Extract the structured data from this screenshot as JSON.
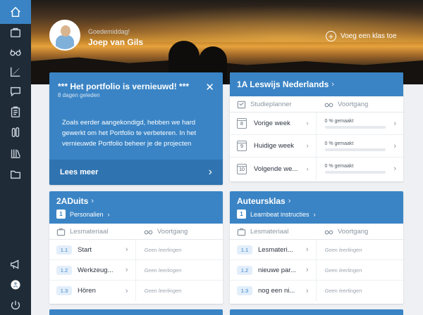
{
  "sidebar": {
    "items": [
      {
        "name": "home-icon",
        "active": true
      },
      {
        "name": "briefcase-icon"
      },
      {
        "name": "glasses-icon"
      },
      {
        "name": "chart-icon"
      },
      {
        "name": "chat-icon"
      },
      {
        "name": "clipboard-icon"
      },
      {
        "name": "tools-icon"
      },
      {
        "name": "library-icon"
      },
      {
        "name": "folder-icon"
      }
    ],
    "bottom": [
      {
        "name": "megaphone-icon"
      },
      {
        "name": "avatar-small-icon"
      },
      {
        "name": "power-icon"
      }
    ]
  },
  "header": {
    "greeting": "Goedemiddag!",
    "user_name": "Joep van Gils",
    "add_class_label": "Voeg een klas toe"
  },
  "announcement": {
    "title": "*** Het portfolio is vernieuwd! ***",
    "subtitle": "8 dagen geleden",
    "body": "Zoals eerder aangekondigd, hebben we hard gewerkt om het Portfolio te verbeteren. In het vernieuwde Portfolio beheer je de projecten",
    "read_more": "Lees meer"
  },
  "card_leswijs": {
    "title": "1A Leswijs Nederlands",
    "col1": "Studieplanner",
    "col2": "Voortgang",
    "rows": [
      {
        "day": "8",
        "label": "Vorige week",
        "progress_text": "0 % gemaakt",
        "progress": 0
      },
      {
        "day": "9",
        "label": "Huidige week",
        "progress_text": "0 % gemaakt",
        "progress": 0
      },
      {
        "day": "10",
        "label": "Volgende we...",
        "progress_text": "0 % gemaakt",
        "progress": 0
      }
    ]
  },
  "card_duits": {
    "title": "2ADuits",
    "sub_number": "1",
    "sub_label": "Personalien",
    "col1": "Lesmateriaal",
    "col2": "Voortgang",
    "rows": [
      {
        "badge": "1.1",
        "label": "Start",
        "status": "Geen leerlingen"
      },
      {
        "badge": "1.2",
        "label": "Werkzeug...",
        "status": "Geen leerlingen"
      },
      {
        "badge": "1.3",
        "label": "Hören",
        "status": "Geen leerlingen"
      }
    ]
  },
  "card_auteurs": {
    "title": "Auteursklas",
    "sub_number": "1",
    "sub_label": "Learnbeat instructies",
    "col1": "Lesmateriaal",
    "col2": "Voortgang",
    "rows": [
      {
        "badge": "1.1",
        "label": "Lesmateri...",
        "status": "Geen leerlingen"
      },
      {
        "badge": "1.2",
        "label": "nieuwe par...",
        "status": "Geen leerlingen"
      },
      {
        "badge": "1.3",
        "label": "nog een ni...",
        "status": "Geen leerlingen"
      }
    ]
  },
  "colors": {
    "accent": "#3a84c5",
    "sidebar": "#1f2b36",
    "background": "#eef0f3"
  }
}
